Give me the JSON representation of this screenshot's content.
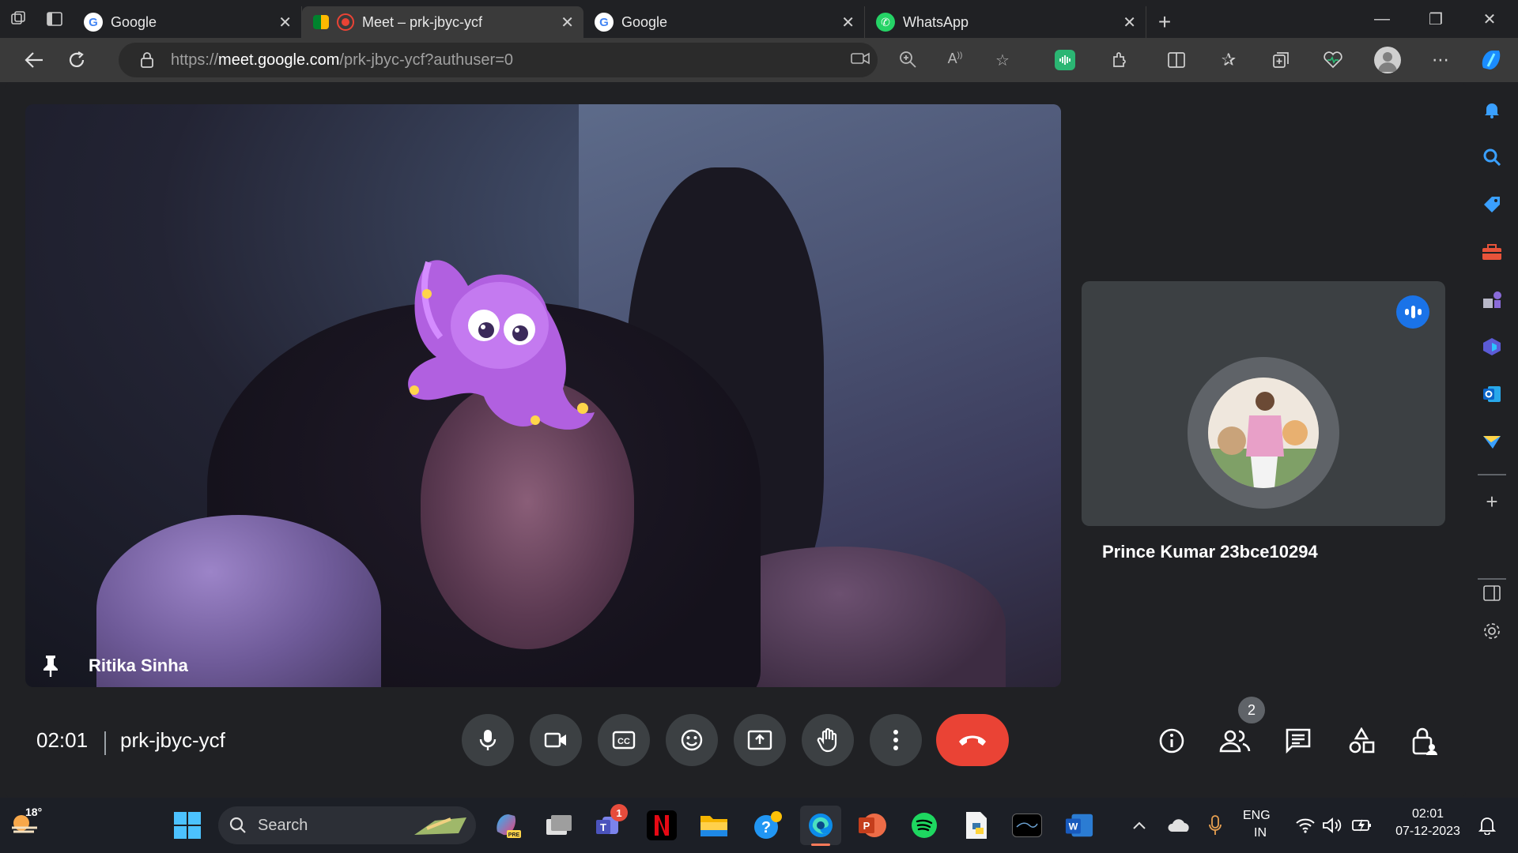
{
  "browser": {
    "tabs": [
      {
        "title": "Google",
        "icon": "google-icon",
        "active": false
      },
      {
        "title": "Meet – prk-jbyc-ycf",
        "icon": "meet-icon",
        "active": true
      },
      {
        "title": "Google",
        "icon": "google-icon",
        "active": false
      },
      {
        "title": "WhatsApp",
        "icon": "whatsapp-icon",
        "active": false
      }
    ],
    "url_prefix": "https://",
    "url_host": "meet.google.com",
    "url_path": "/prk-jbyc-ycf?authuser=0"
  },
  "meet": {
    "main_participant": "Ritika Sinha",
    "side_participant": "Prince Kumar 23bce10294",
    "timer": "02:01",
    "meeting_code": "prk-jbyc-ycf",
    "participant_count": "2",
    "end_call_color": "#ea4335",
    "speaking_color": "#1a73e8"
  },
  "taskbar": {
    "weather": "18°",
    "search_placeholder": "Search",
    "teams_badge": "1",
    "language_top": "ENG",
    "language_bottom": "IN",
    "time": "02:01",
    "date": "07-12-2023"
  }
}
